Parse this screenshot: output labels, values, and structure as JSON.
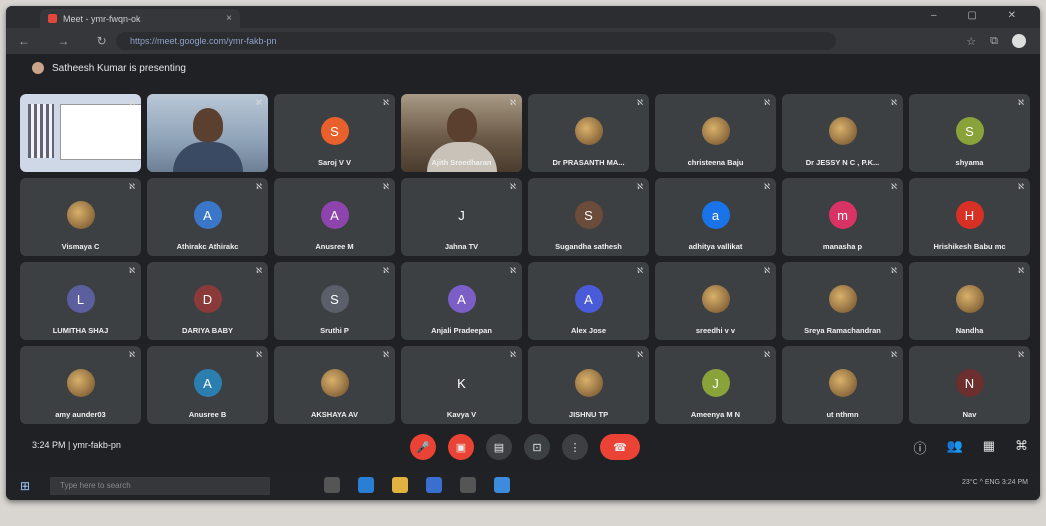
{
  "browser": {
    "tab_title": "Meet - ymr-fwqn-ok",
    "url": "https://meet.google.com/ymr-fakb-pn",
    "close_glyph": "×",
    "window_controls": "–  ▢  ✕",
    "nav_glyphs": "←  →  ↻"
  },
  "meeting": {
    "presenting_text": "Satheesh Kumar is presenting",
    "time_code": "3:24 PM  |  ymr-fakb-pn",
    "participants": [
      {
        "name": "",
        "type": "shared"
      },
      {
        "name": "",
        "type": "video-blue"
      },
      {
        "name": "Saroj V V",
        "initial": "S",
        "color": "#e8602c"
      },
      {
        "name": "Ajith Sreedharan",
        "type": "video"
      },
      {
        "name": "Dr PRASANTH MA...",
        "photo": true
      },
      {
        "name": "christeena Baju",
        "photo": true
      },
      {
        "name": "Dr JESSY N C , P.K...",
        "photo": true
      },
      {
        "name": "shyama",
        "initial": "S",
        "color": "#8aa23a"
      },
      {
        "name": "Vismaya C",
        "photo": true
      },
      {
        "name": "Athirakc Athirakc",
        "initial": "A",
        "color": "#3b77c8"
      },
      {
        "name": "Anusree M",
        "initial": "A",
        "color": "#8e44ad"
      },
      {
        "name": "Jahna TV",
        "initial": "J",
        "color": "#3c4043"
      },
      {
        "name": "Sugandha sathesh",
        "initial": "S",
        "color": "#6b4c3b"
      },
      {
        "name": "adhitya vallikat",
        "initial": "a",
        "color": "#1a73e8"
      },
      {
        "name": "manasha p",
        "initial": "m",
        "color": "#d93366"
      },
      {
        "name": "Hrishikesh Babu mc",
        "initial": "H",
        "color": "#d93025"
      },
      {
        "name": "LUMITHA SHAJ",
        "initial": "L",
        "color": "#5c5f9e"
      },
      {
        "name": "DARIYA BABY",
        "initial": "D",
        "color": "#8b3a3a"
      },
      {
        "name": "Sruthi P",
        "initial": "S",
        "color": "#5a5f6a"
      },
      {
        "name": "Anjali Pradeepan",
        "initial": "A",
        "color": "#7b5fc7"
      },
      {
        "name": "Alex Jose",
        "initial": "A",
        "color": "#4a5bd9"
      },
      {
        "name": "sreedhi v v",
        "photo": true
      },
      {
        "name": "Sreya Ramachandran",
        "photo": true
      },
      {
        "name": "Nandha",
        "photo": true
      },
      {
        "name": "amy aunder03",
        "photo": true
      },
      {
        "name": "Anusree B",
        "initial": "A",
        "color": "#2a7fb0"
      },
      {
        "name": "AKSHAYA AV",
        "photo": true
      },
      {
        "name": "Kavya V",
        "initial": "K",
        "color": "#3c4043"
      },
      {
        "name": "JISHNU TP",
        "photo": true
      },
      {
        "name": "Ameenya M N",
        "initial": "J",
        "color": "#8aa23a"
      },
      {
        "name": "ut nthmn",
        "photo": true
      },
      {
        "name": "Nav",
        "initial": "N",
        "color": "#6b2f2f"
      }
    ]
  },
  "controls": {
    "mic_glyph": "🎤",
    "cam_glyph": "▣",
    "cc_glyph": "▤",
    "present_glyph": "⊡",
    "more_glyph": "⋮",
    "hangup_glyph": "☎",
    "info_glyph": "ⓘ",
    "people_glyph": "👥",
    "chat_glyph": "▦",
    "activities_glyph": "⌘"
  },
  "taskbar": {
    "search_placeholder": "Type here to search",
    "tray_text": "23°C  ^  ENG  3:24 PM"
  }
}
